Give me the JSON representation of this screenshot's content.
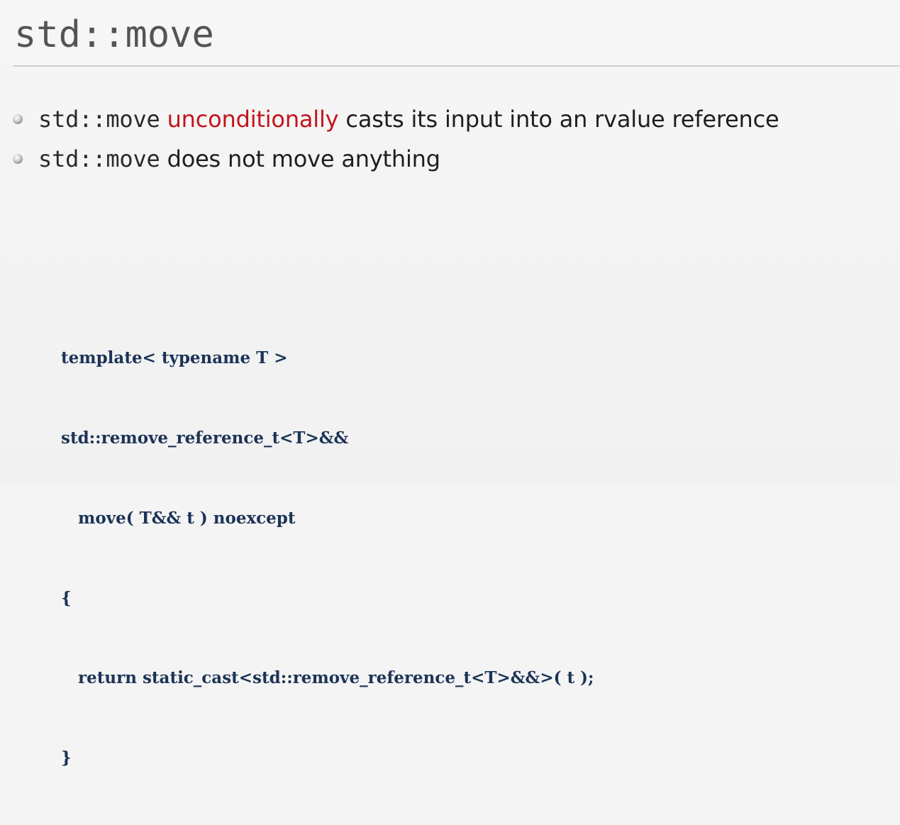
{
  "slide": {
    "title": "std::move",
    "bullets": [
      {
        "code": "std::move",
        "emphasis": "unconditionally",
        "rest": "casts its input into an rvalue reference"
      },
      {
        "code": "std::move",
        "rest": "does not move anything"
      }
    ],
    "code_lines": [
      "template< typename T >",
      "std::remove_reference_t<T>&&",
      "   move( T&& t ) noexcept",
      "{",
      "   return static_cast<std::remove_reference_t<T>&&>( t );",
      "}"
    ],
    "colors": {
      "emphasis": "#c3141c",
      "code": "#1c3357",
      "title": "#545454"
    },
    "icons": [
      "bullet-icon"
    ]
  }
}
